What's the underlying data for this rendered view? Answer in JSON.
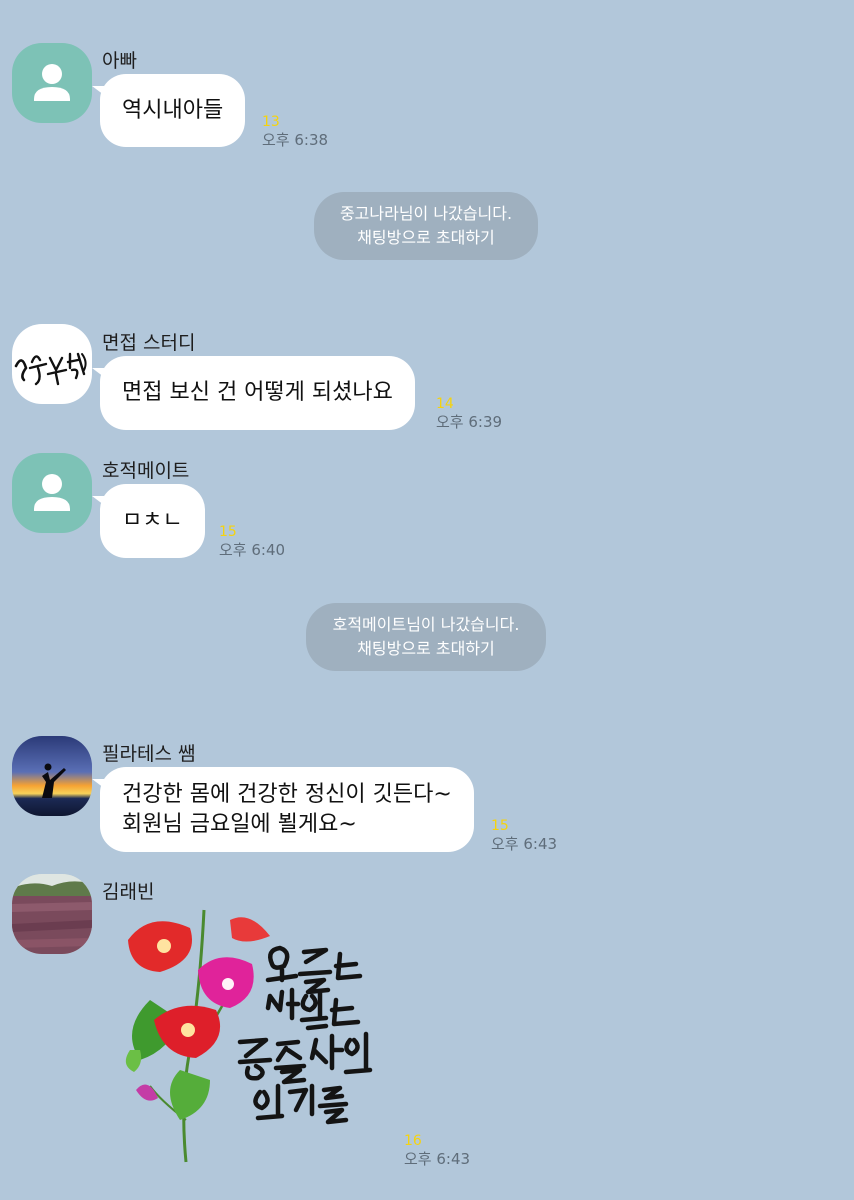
{
  "messages": [
    {
      "sender": "아빠",
      "text": "역시내아들",
      "unread": "13",
      "time": "오후 6:38"
    },
    {
      "sender": "면접 스터디",
      "text": "면접 보신 건 어떻게 되셨나요",
      "unread": "14",
      "time": "오후 6:39",
      "avatar_text": "할수있다"
    },
    {
      "sender": "호적메이트",
      "text": "ㅁㅊㄴ",
      "unread": "15",
      "time": "오후 6:40"
    },
    {
      "sender": "필라테스 쌤",
      "text_line1": "건강한 몸에 건강한 정신이 깃든다~",
      "text_line2": "회원님 금요일에 뵐게요~",
      "unread": "15",
      "time": "오후 6:43"
    },
    {
      "sender": "김래빈",
      "sticker_text": "오늘도 내일도 좋은 소식만 있기를",
      "unread": "16",
      "time": "오후 6:43"
    }
  ],
  "system_messages": [
    {
      "line1": "중고나라님이 나갔습니다.",
      "line2": "채팅방으로 초대하기"
    },
    {
      "line1": "호적메이트님이 나갔습니다.",
      "line2": "채팅방으로 초대하기"
    }
  ],
  "colors": {
    "background": "#b2c7da",
    "bubble": "#ffffff",
    "unread": "#f5d30f",
    "default_avatar": "#7dc2b6",
    "system_bubble": "#9fb0bf"
  },
  "icons": [
    "default-profile-icon",
    "yoga-sunset-avatar",
    "flower-field-avatar",
    "morning-glory-sticker"
  ]
}
